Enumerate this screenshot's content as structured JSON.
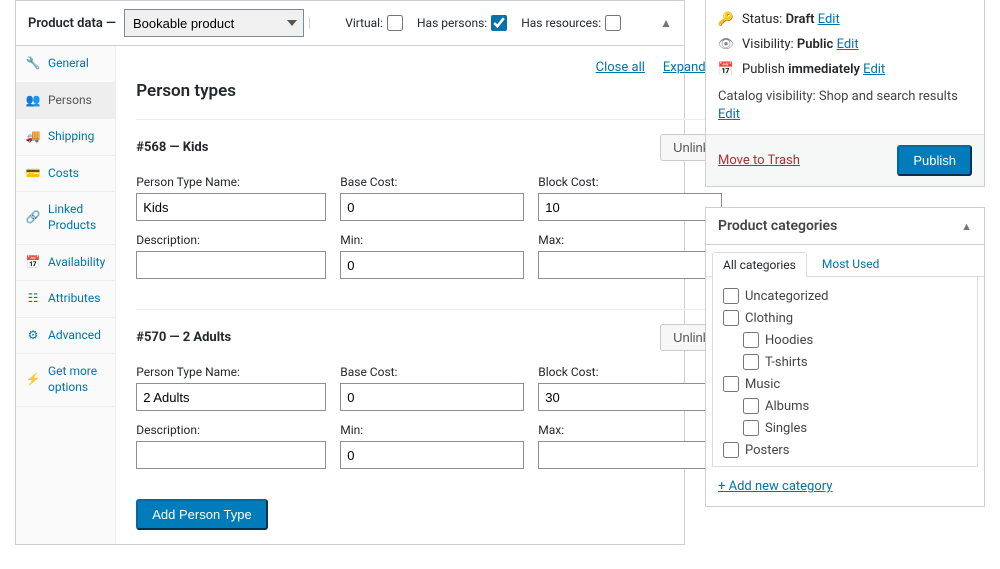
{
  "product_panel": {
    "title_prefix": "Product data —",
    "product_type": "Bookable product",
    "checks": {
      "virtual_label": "Virtual:",
      "virtual_checked": false,
      "has_persons_label": "Has persons:",
      "has_persons_checked": true,
      "has_resources_label": "Has resources:",
      "has_resources_checked": false
    }
  },
  "tabs": [
    {
      "key": "general",
      "label": "General",
      "icon": "wrench"
    },
    {
      "key": "persons",
      "label": "Persons",
      "icon": "users",
      "active": true
    },
    {
      "key": "shipping",
      "label": "Shipping",
      "icon": "truck"
    },
    {
      "key": "costs",
      "label": "Costs",
      "icon": "card"
    },
    {
      "key": "linked",
      "label": "Linked Products",
      "icon": "link"
    },
    {
      "key": "availability",
      "label": "Availability",
      "icon": "calendar"
    },
    {
      "key": "attributes",
      "label": "Attributes",
      "icon": "list"
    },
    {
      "key": "advanced",
      "label": "Advanced",
      "icon": "gear"
    },
    {
      "key": "getmore",
      "label": "Get more options",
      "icon": "bolt"
    }
  ],
  "content": {
    "close_all": "Close all",
    "expand_all": "Expand all",
    "section_title": "Person types",
    "labels": {
      "person_type_name": "Person Type Name:",
      "base_cost": "Base Cost:",
      "block_cost": "Block Cost:",
      "description": "Description:",
      "min": "Min:",
      "max": "Max:",
      "unlink": "Unlink",
      "add_person_type": "Add Person Type"
    },
    "persons": [
      {
        "id": "#568",
        "heading": "#568 — Kids",
        "name": "Kids",
        "base_cost": "0",
        "block_cost": "10",
        "description": "",
        "min": "0",
        "max": ""
      },
      {
        "id": "#570",
        "heading": "#570 — 2 Adults",
        "name": "2 Adults",
        "base_cost": "0",
        "block_cost": "30",
        "description": "",
        "min": "0",
        "max": ""
      }
    ]
  },
  "publish_box": {
    "status_label": "Status:",
    "status_value": "Draft",
    "visibility_label": "Visibility:",
    "visibility_value": "Public",
    "publish_label": "Publish",
    "publish_value": "immediately",
    "edit": "Edit",
    "catalog_label": "Catalog visibility:",
    "catalog_value": "Shop and search results",
    "trash": "Move to Trash",
    "publish_btn": "Publish"
  },
  "categories_box": {
    "title": "Product categories",
    "tab_all": "All categories",
    "tab_most": "Most Used",
    "items": [
      {
        "label": "Uncategorized",
        "indent": 0
      },
      {
        "label": "Clothing",
        "indent": 0
      },
      {
        "label": "Hoodies",
        "indent": 1
      },
      {
        "label": "T-shirts",
        "indent": 1
      },
      {
        "label": "Music",
        "indent": 0
      },
      {
        "label": "Albums",
        "indent": 1
      },
      {
        "label": "Singles",
        "indent": 1
      },
      {
        "label": "Posters",
        "indent": 0
      }
    ],
    "add_new": "+ Add new category"
  }
}
